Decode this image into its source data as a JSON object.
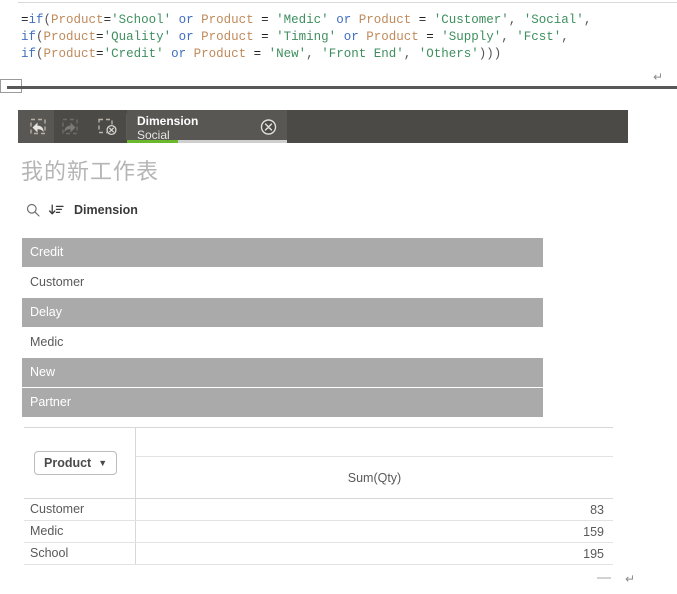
{
  "code_editor": {
    "lines": [
      [
        {
          "t": "=",
          "c": "op"
        },
        {
          "t": "if",
          "c": "kw"
        },
        {
          "t": "(",
          "c": "punct"
        },
        {
          "t": "Product",
          "c": "field"
        },
        {
          "t": "=",
          "c": "op"
        },
        {
          "t": "'School'",
          "c": "str"
        },
        {
          "t": " ",
          "c": "op"
        },
        {
          "t": "or",
          "c": "kw"
        },
        {
          "t": " ",
          "c": "op"
        },
        {
          "t": "Product",
          "c": "field"
        },
        {
          "t": " = ",
          "c": "op"
        },
        {
          "t": "'Medic'",
          "c": "str"
        },
        {
          "t": " ",
          "c": "op"
        },
        {
          "t": "or",
          "c": "kw"
        },
        {
          "t": " ",
          "c": "op"
        },
        {
          "t": "Product",
          "c": "field"
        },
        {
          "t": " = ",
          "c": "op"
        },
        {
          "t": "'Customer'",
          "c": "str"
        },
        {
          "t": ", ",
          "c": "punct"
        },
        {
          "t": "'Social'",
          "c": "str"
        },
        {
          "t": ",",
          "c": "punct"
        }
      ],
      [
        {
          "t": "if",
          "c": "kw"
        },
        {
          "t": "(",
          "c": "punct"
        },
        {
          "t": "Product",
          "c": "field"
        },
        {
          "t": "=",
          "c": "op"
        },
        {
          "t": "'Quality'",
          "c": "str"
        },
        {
          "t": " ",
          "c": "op"
        },
        {
          "t": "or",
          "c": "kw"
        },
        {
          "t": " ",
          "c": "op"
        },
        {
          "t": "Product",
          "c": "field"
        },
        {
          "t": " = ",
          "c": "op"
        },
        {
          "t": "'Timing'",
          "c": "str"
        },
        {
          "t": " ",
          "c": "op"
        },
        {
          "t": "or",
          "c": "kw"
        },
        {
          "t": " ",
          "c": "op"
        },
        {
          "t": "Product",
          "c": "field"
        },
        {
          "t": " = ",
          "c": "op"
        },
        {
          "t": "'Supply'",
          "c": "str"
        },
        {
          "t": ", ",
          "c": "punct"
        },
        {
          "t": "'Fcst'",
          "c": "str"
        },
        {
          "t": ",",
          "c": "punct"
        }
      ],
      [
        {
          "t": "if",
          "c": "kw"
        },
        {
          "t": "(",
          "c": "punct"
        },
        {
          "t": "Product",
          "c": "field"
        },
        {
          "t": "=",
          "c": "op"
        },
        {
          "t": "'Credit'",
          "c": "str"
        },
        {
          "t": " ",
          "c": "op"
        },
        {
          "t": "or",
          "c": "kw"
        },
        {
          "t": " ",
          "c": "op"
        },
        {
          "t": "Product",
          "c": "field"
        },
        {
          "t": " = ",
          "c": "op"
        },
        {
          "t": "'New'",
          "c": "str"
        },
        {
          "t": ", ",
          "c": "punct"
        },
        {
          "t": "'Front End'",
          "c": "str"
        },
        {
          "t": ", ",
          "c": "punct"
        },
        {
          "t": "'Others'",
          "c": "str"
        },
        {
          "t": ")))",
          "c": "punct"
        }
      ]
    ],
    "return_mark": "↵",
    "colors": {
      "keyword": "#3f6fbf",
      "field": "#c08b5c",
      "string": "#3f8f5f",
      "operator": "#1f1f1f"
    }
  },
  "selections_bar": {
    "background": "#4c4a47",
    "buttons": [
      {
        "name": "step-back-in-selections",
        "icon": "undo-selection-icon",
        "enabled": true
      },
      {
        "name": "step-forward-in-selections",
        "icon": "redo-selection-icon",
        "enabled": false
      },
      {
        "name": "clear-all-selections",
        "icon": "clear-selection-icon",
        "enabled": true
      }
    ],
    "chip": {
      "dimension_label": "Dimension",
      "value_label": "Social",
      "close_icon": "close-circle-icon",
      "bar_green_pct": 32,
      "bar_green_color": "#6ab82e",
      "bar_grey_color": "#cfcfcf"
    }
  },
  "sheet": {
    "title": "我的新工作表"
  },
  "filter_pane": {
    "search_icon": "search-icon",
    "sort_icon": "sort-descending-icon",
    "title": "Dimension",
    "items": [
      {
        "label": "Credit",
        "state": "excluded"
      },
      {
        "label": "Customer",
        "state": "available"
      },
      {
        "label": "Delay",
        "state": "excluded"
      },
      {
        "label": "Medic",
        "state": "available"
      },
      {
        "label": "New",
        "state": "excluded"
      },
      {
        "label": "Partner",
        "state": "excluded"
      }
    ],
    "state_colors": {
      "excluded_bg": "#aaaaaa",
      "excluded_text": "#ffffff",
      "available_bg": "#ffffff",
      "available_text": "#595959"
    }
  },
  "pivot_table": {
    "dimension_button": {
      "label": "Product",
      "caret": "▼"
    },
    "measure_header": "Sum(Qty)",
    "rows": [
      {
        "dimension": "Customer",
        "value": "83"
      },
      {
        "dimension": "Medic",
        "value": "159"
      },
      {
        "dimension": "School",
        "value": "195"
      }
    ]
  }
}
